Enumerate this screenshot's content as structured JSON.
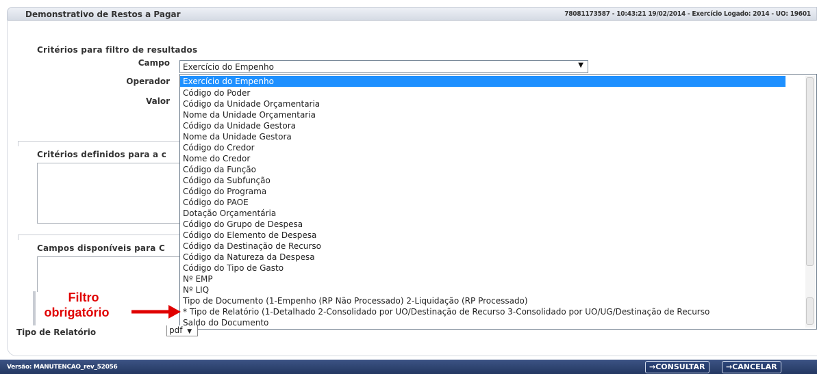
{
  "header": {
    "title": "Demonstrativo de Restos a Pagar",
    "info": "78081173587 - 10:43:21 19/02/2014 - Exercício Logado: 2014 - UO: 19601"
  },
  "filter": {
    "section_title": "Critérios para filtro de resultados",
    "campo_label": "Campo",
    "operador_label": "Operador",
    "valor_label": "Valor",
    "campo_selected": "Exercício do Empenho",
    "options": [
      "Exercício do Empenho",
      "Código do Poder",
      "Código da Unidade Orçamentaria",
      "Nome da Unidade Orçamentaria",
      "Código da Unidade Gestora",
      "Nome da Unidade Gestora",
      "Código do Credor",
      "Nome do Credor",
      "Código da Função",
      "Código da Subfunção",
      "Código do Programa",
      "Código do PAOE",
      "Dotação Orçamentária",
      "Código do Grupo de Despesa",
      "Código do Elemento de Despesa",
      "Código da Destinação de Recurso",
      "Código da Natureza da Despesa",
      "Código do Tipo de Gasto",
      "Nº EMP",
      "Nº LIQ",
      "Tipo de Documento (1-Empenho (RP Não Processado) 2-Liquidação (RP Processado)",
      "* Tipo de Relatório (1-Detalhado 2-Consolidado por UO/Destinação de Recurso 3-Consolidado por UO/UG/Destinação de Recurso",
      "Saldo do Documento"
    ]
  },
  "criterios_definidos": {
    "title": "Critérios definidos para a c"
  },
  "campos_disponiveis": {
    "title": "Campos disponíveis para C"
  },
  "annotation": {
    "line1": "Filtro",
    "line2": "obrigatório",
    "color": "#e00000"
  },
  "report": {
    "label": "Tipo de Relatório",
    "format": "pdf"
  },
  "footer": {
    "version": "Versão: MANUTENCAO_rev_52056",
    "consultar": "→CONSULTAR",
    "cancelar": "→CANCELAR"
  },
  "colors": {
    "selection": "#1e90ff",
    "footer": "#2b3f6c"
  }
}
